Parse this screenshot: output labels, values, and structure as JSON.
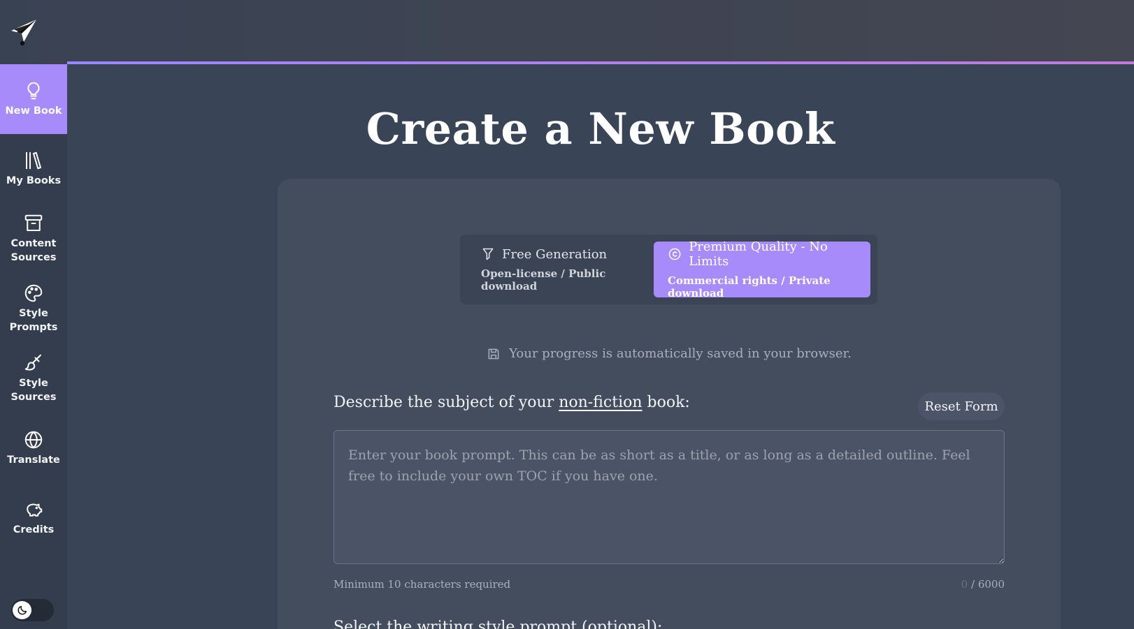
{
  "sidebar": {
    "items": [
      {
        "label": "New Book",
        "icon": "lightbulb-icon",
        "active": true
      },
      {
        "label": "My Books",
        "icon": "library-icon"
      },
      {
        "label": "Content Sources",
        "icon": "archive-icon"
      },
      {
        "label": "Style Prompts",
        "icon": "palette-icon"
      },
      {
        "label": "Style Sources",
        "icon": "paintbrush-icon"
      },
      {
        "label": "Translate",
        "icon": "globe-icon"
      },
      {
        "label": "Credits",
        "icon": "piggy-bank-icon"
      }
    ]
  },
  "main": {
    "title": "Create a New Book",
    "mode": {
      "free": {
        "title": "Free Generation",
        "subtitle": "Open-license / Public download"
      },
      "premium": {
        "title": "Premium Quality - No Limits",
        "subtitle": "Commercial rights / Private download"
      },
      "selected": "premium"
    },
    "autosave": "Your progress is automatically saved in your browser.",
    "prompt": {
      "label_prefix": "Describe the subject of your ",
      "label_link": "non-fiction",
      "label_suffix": " book:",
      "placeholder": "Enter your book prompt. This can be as short as a title, or as long as a detailed outline. Feel free to include your own TOC if you have one.",
      "value": "",
      "min_hint": "Minimum 10 characters required",
      "count": "0",
      "max": "6000",
      "count_sep": " / "
    },
    "reset_label": "Reset Form",
    "next_label": "Select the writing style prompt (optional):"
  },
  "colors": {
    "accent": "#a78bfa",
    "topbar_gradient_end": "#c07cdb"
  }
}
